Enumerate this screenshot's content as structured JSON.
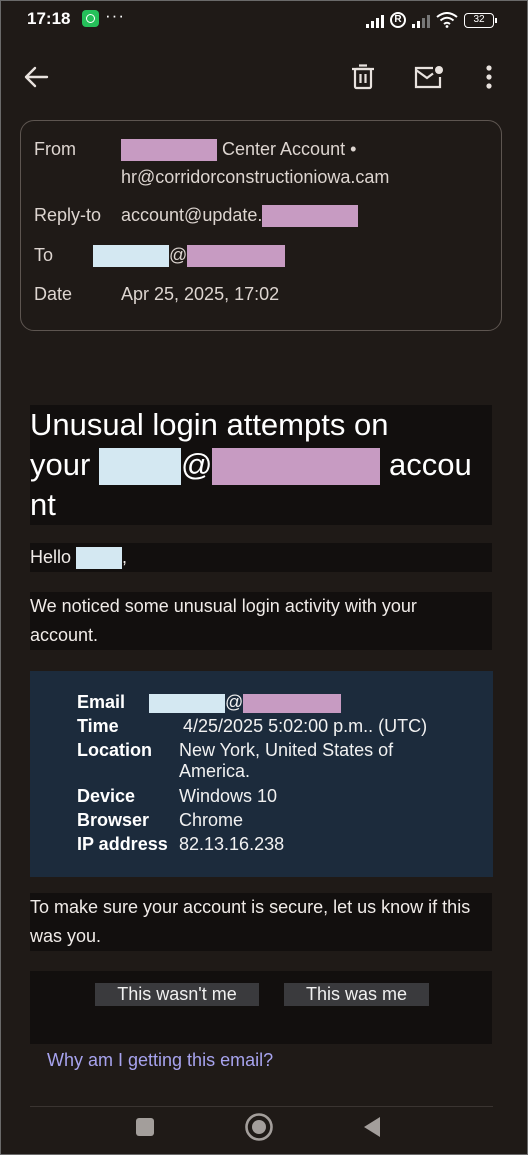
{
  "status_bar": {
    "time": "17:18",
    "more": "···",
    "roaming": "R",
    "battery": "32",
    "icons": [
      "whatsapp-icon",
      "signal-icon",
      "roaming-icon",
      "signal-icon",
      "wifi-icon",
      "battery-icon"
    ]
  },
  "app_bar": {
    "icons": [
      "back-arrow-icon",
      "delete-icon",
      "mark-unread-icon",
      "more-vert-icon"
    ]
  },
  "header": {
    "from_label": "From",
    "from_name_suffix": "Center Account •",
    "from_email": "hr@corridorconstructioniowa.cam",
    "reply_to_label": "Reply-to",
    "reply_to_value": "account@update.",
    "to_label": "To",
    "at_sign": "@",
    "date_label": "Date",
    "date_value": "Apr 25, 2025, 17:02"
  },
  "email": {
    "headline_part1": "Unusual login attempts on",
    "headline_your": "your",
    "headline_at": "@",
    "headline_accou": "accou",
    "headline_nt": "nt",
    "greeting": "Hello",
    "greeting_comma": ",",
    "intro": "We noticed some unusual login activity with your account.",
    "details": {
      "email_label": "Email",
      "email_at": "@",
      "time_label": "Time",
      "time_value": "4/25/2025 5:02:00 p.m.. (UTC)",
      "location_label": "Location",
      "location_line1": "New York, United States of",
      "location_line2": "America.",
      "device_label": "Device",
      "device_value": "Windows 10",
      "browser_label": "Browser",
      "browser_value": "Chrome",
      "ip_label": "IP address",
      "ip_value": "82.13.16.238"
    },
    "prompt": "To make sure your account is secure, let us know if this was you.",
    "button_not_me": "This wasn't me",
    "button_me": "This was me",
    "why_link": "Why am I getting this email?"
  },
  "nav_bar": {
    "icons": [
      "recents-square-icon",
      "home-circle-icon",
      "back-triangle-icon"
    ]
  },
  "colors": {
    "background": "#1f1a17",
    "info_box": "#1c2b3c",
    "link": "#a7a3ee",
    "redaction_pink": "#c79bc2",
    "redaction_blue": "#d4e8f2"
  }
}
